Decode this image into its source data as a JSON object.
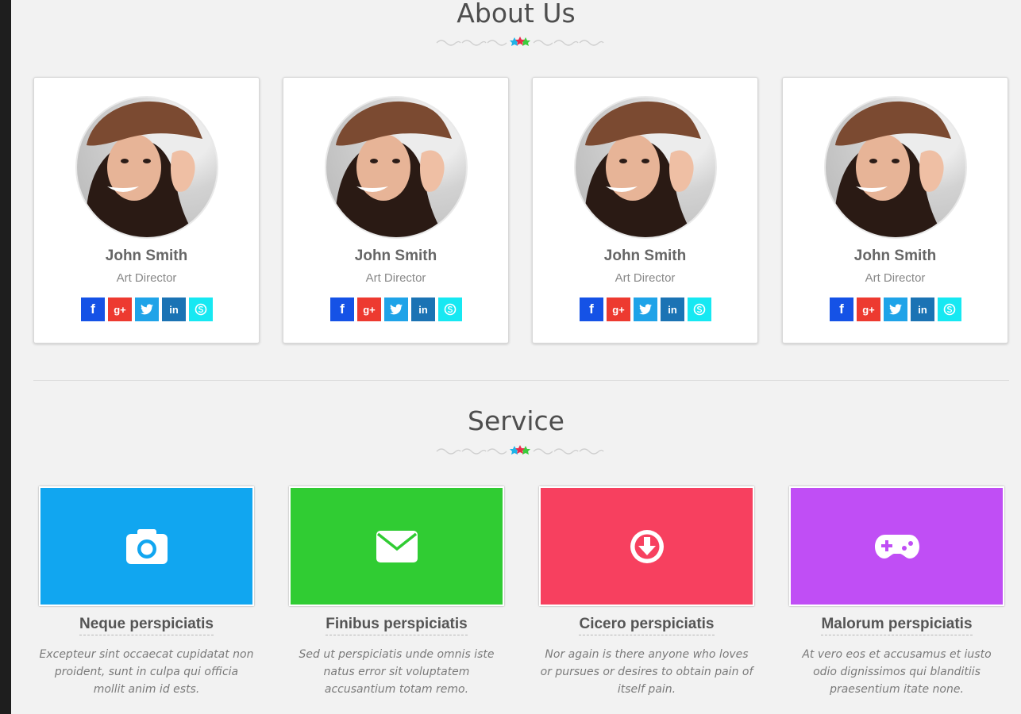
{
  "about": {
    "title": "About Us",
    "members": [
      {
        "name": "John Smith",
        "role": "Art Director"
      },
      {
        "name": "John Smith",
        "role": "Art Director"
      },
      {
        "name": "John Smith",
        "role": "Art Director"
      },
      {
        "name": "John Smith",
        "role": "Art Director"
      }
    ],
    "social_labels": {
      "facebook": "f",
      "google_plus": "g+",
      "twitter": "twitter",
      "linkedin": "in",
      "skype": "skype"
    }
  },
  "service": {
    "title": "Service",
    "items": [
      {
        "heading": "Neque perspiciatis",
        "description": "Excepteur sint occaecat cupidatat non proident, sunt in culpa qui officia mollit anim id ests.",
        "color": "#11a6f0",
        "icon": "camera-icon"
      },
      {
        "heading": "Finibus perspiciatis",
        "description": "Sed ut perspiciatis unde omnis iste natus error sit voluptatem accusantium totam remo.",
        "color": "#30cc33",
        "icon": "envelope-icon"
      },
      {
        "heading": "Cicero perspiciatis",
        "description": "Nor again is there anyone who loves or pursues or desires to obtain pain of itself pain.",
        "color": "#f7405f",
        "icon": "download-circle-icon"
      },
      {
        "heading": "Malorum perspiciatis",
        "description": "At vero eos et accusamus et iusto odio dignissimos qui blanditiis praesentium itate none.",
        "color": "#c04ef5",
        "icon": "gamepad-icon"
      }
    ]
  },
  "colors": {
    "facebook": "#1552e6",
    "google_plus": "#ed3a30",
    "twitter": "#1fa3e8",
    "linkedin": "#1b73b4",
    "skype": "#17e8f2",
    "heading": "#4e4e4e"
  }
}
